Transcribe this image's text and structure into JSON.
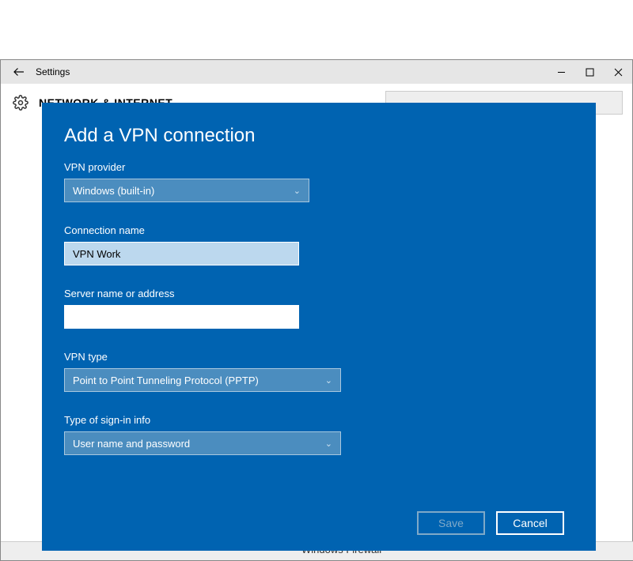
{
  "titlebar": {
    "title": "Settings"
  },
  "header": {
    "label": "NETWORK & INTERNET"
  },
  "dialog": {
    "title": "Add a VPN connection",
    "provider": {
      "label": "VPN provider",
      "value": "Windows (built-in)"
    },
    "connection_name": {
      "label": "Connection name",
      "value": "VPN Work"
    },
    "server": {
      "label": "Server name or address",
      "value": ""
    },
    "vpn_type": {
      "label": "VPN type",
      "value": "Point to Point Tunneling Protocol (PPTP)"
    },
    "signin": {
      "label": "Type of sign-in info",
      "value": "User name and password"
    },
    "save": "Save",
    "cancel": "Cancel"
  },
  "bottom": {
    "firewall": "Windows Firewall"
  }
}
